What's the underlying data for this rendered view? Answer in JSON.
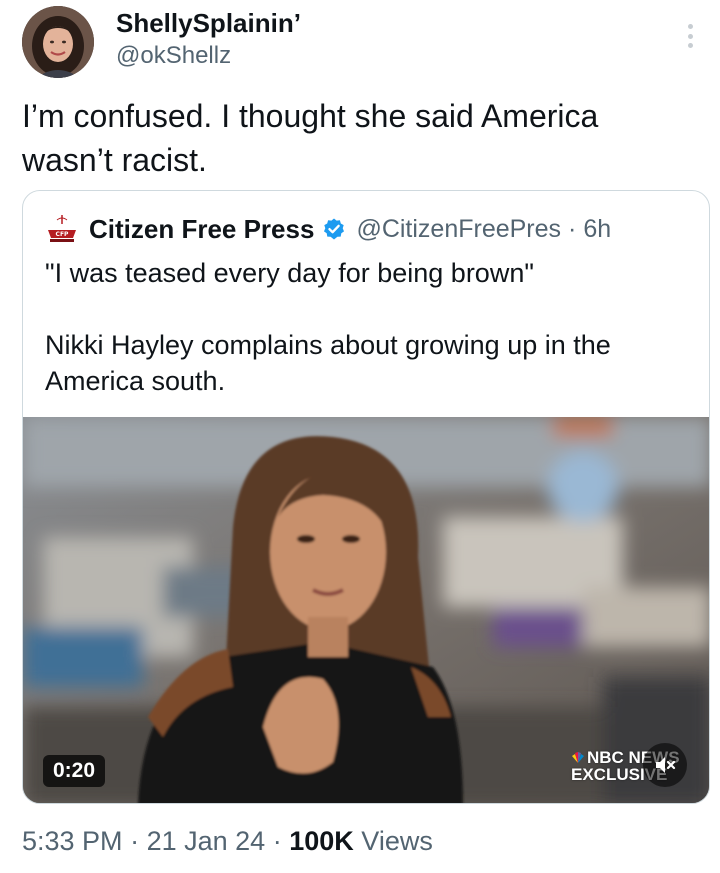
{
  "author": {
    "display_name": "ShellySplainin’",
    "handle": "@okShellz"
  },
  "tweet": {
    "lines": [
      "I’m confused.  I thought she said America",
      "wasn’t racist."
    ]
  },
  "quoted": {
    "name": "Citizen Free Press",
    "handle": "@CitizenFreePres",
    "separator": "·",
    "time": "6h",
    "line1": "\"I was teased every day for being brown\"",
    "line2": "Nikki Hayley complains about growing up in the",
    "line3": "America south.",
    "media": {
      "duration": "0:20",
      "watermark_line1": "NBC NEWS",
      "watermark_line2": "EXCLUSIVE"
    }
  },
  "meta": {
    "time": "5:33 PM",
    "sep1": "·",
    "date": "21 Jan 24",
    "sep2": "·",
    "views_count": "100K",
    "views_label": "Views"
  },
  "colors": {
    "text": "#0f1419",
    "secondary": "#536471",
    "border": "#cfd9de",
    "verified": "#1d9bf0"
  },
  "icons": [
    "user-avatar",
    "more-options-icon",
    "citizen-free-press-logo",
    "verified-badge-icon",
    "nbc-peacock-icon",
    "mute-icon"
  ]
}
